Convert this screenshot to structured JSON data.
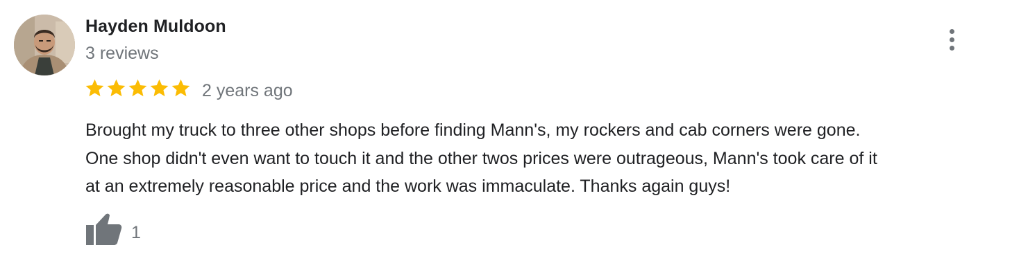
{
  "review": {
    "author_name": "Hayden Muldoon",
    "author_reviews": "3 reviews",
    "rating": 5,
    "rating_max": 5,
    "date": "2 years ago",
    "text_lines": [
      "Brought my truck to three other shops before finding Mann's, my rockers and cab corners were gone.",
      "One shop didn't even want to touch it and the other twos prices were outrageous, Mann's took care of it",
      "at an extremely reasonable price and the work was immaculate. Thanks again guys!"
    ],
    "like_count": "1"
  },
  "icons": {
    "menu": "more-vert-icon",
    "like": "thumbs-up-icon",
    "star": "star-icon",
    "avatar": "avatar-photo"
  },
  "colors": {
    "star": "#fbbc04",
    "primary_text": "#202124",
    "secondary_text": "#70757a"
  }
}
